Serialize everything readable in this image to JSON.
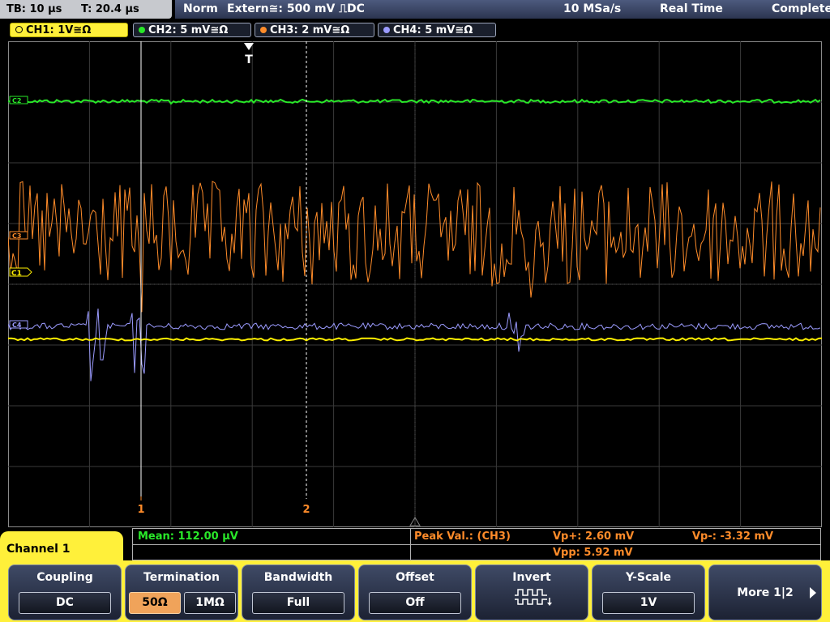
{
  "status": {
    "timebase": "TB: 10 µs",
    "trigger_time": "T: 20.4 µs",
    "trigger_mode": "Norm",
    "trigger_source": "Extern≅: 500 mV ⎍DC",
    "sample_rate": "10 MSa/s",
    "acq_mode": "Real Time",
    "acq_state": "Complete"
  },
  "channels": [
    {
      "label": "CH1: 1V≅Ω",
      "color": "#ffef00"
    },
    {
      "label": "CH2: 5 mV≅Ω",
      "color": "#29e829"
    },
    {
      "label": "CH3: 2 mV≅Ω",
      "color": "#ff8c2a"
    },
    {
      "label": "CH4: 5 mV≅Ω",
      "color": "#9b9bff"
    }
  ],
  "grid": {
    "trigger_marker": "T",
    "cursor_1": "1",
    "cursor_2": "2",
    "ch_markers": {
      "c2": "C2",
      "c3": "C3",
      "c1": "C1",
      "c4": "C4"
    }
  },
  "measurements": {
    "mean": "Mean: 112.00 µV",
    "peak_label": "Peak Val.: (CH3)",
    "vp_plus": "Vp+: 2.60 mV",
    "vp_minus": "Vp-: -3.32 mV",
    "vpp": "Vpp: 5.92 mV"
  },
  "menu": {
    "channel_title": "Channel 1",
    "coupling": {
      "title": "Coupling",
      "value": "DC"
    },
    "termination": {
      "title": "Termination",
      "opt_a": "50Ω",
      "opt_b": "1MΩ",
      "selected": "50Ω"
    },
    "bandwidth": {
      "title": "Bandwidth",
      "value": "Full"
    },
    "offset": {
      "title": "Offset",
      "value": "Off"
    },
    "invert": {
      "title": "Invert"
    },
    "yscale": {
      "title": "Y-Scale",
      "value": "1V"
    },
    "more": {
      "label": "More 1|2"
    }
  },
  "icons": {
    "trigger": "trigger-marker-icon",
    "invert": "invert-waveform-icon",
    "more": "arrow-right-icon"
  }
}
